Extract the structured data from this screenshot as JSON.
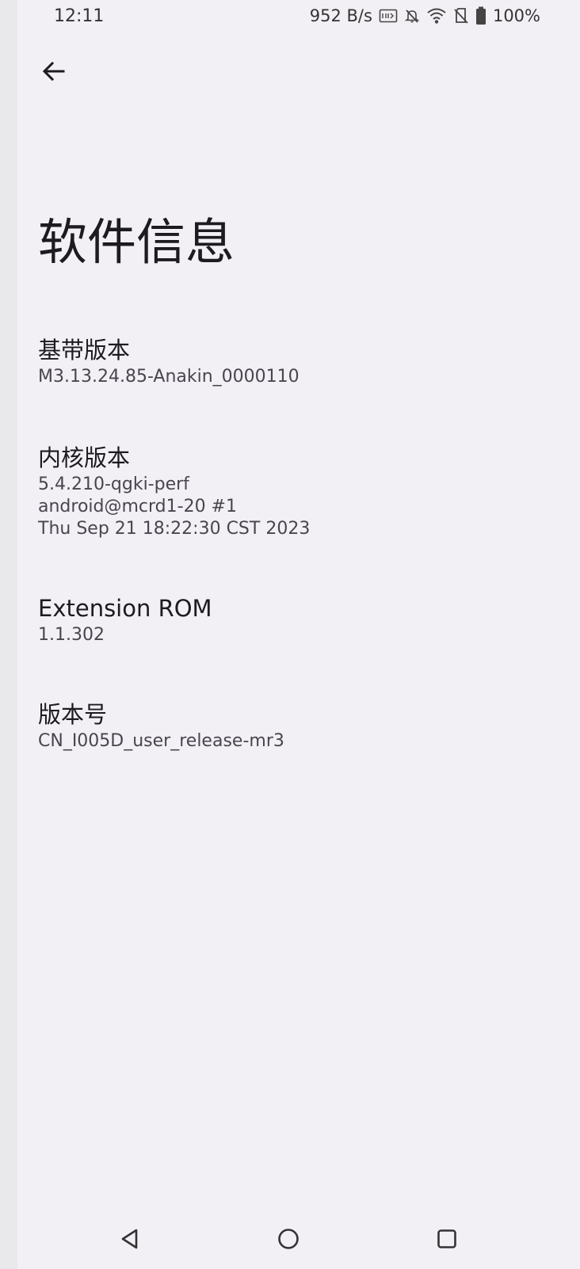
{
  "status_bar": {
    "time": "12:11",
    "net_speed": "952 B/s",
    "battery": "100%",
    "icons": [
      "volte-icon",
      "mute-bell-icon",
      "wifi-icon",
      "no-sim-icon",
      "battery-icon"
    ]
  },
  "header": {
    "back_icon": "arrow-left-icon",
    "title": "软件信息"
  },
  "items": [
    {
      "label": "基带版本",
      "value_lines": [
        "M3.13.24.85-Anakin_0000110"
      ]
    },
    {
      "label": "内核版本",
      "value_lines": [
        "5.4.210-qgki-perf",
        "android@mcrd1-20 #1",
        "Thu Sep 21 18:22:30 CST 2023"
      ]
    },
    {
      "label": "Extension ROM",
      "value_lines": [
        "1.1.302"
      ]
    },
    {
      "label": "版本号",
      "value_lines": [
        "CN_I005D_user_release-mr3"
      ]
    }
  ],
  "nav_bar": {
    "icons": [
      "nav-back-triangle-icon",
      "nav-home-circle-icon",
      "nav-recents-square-icon"
    ]
  }
}
